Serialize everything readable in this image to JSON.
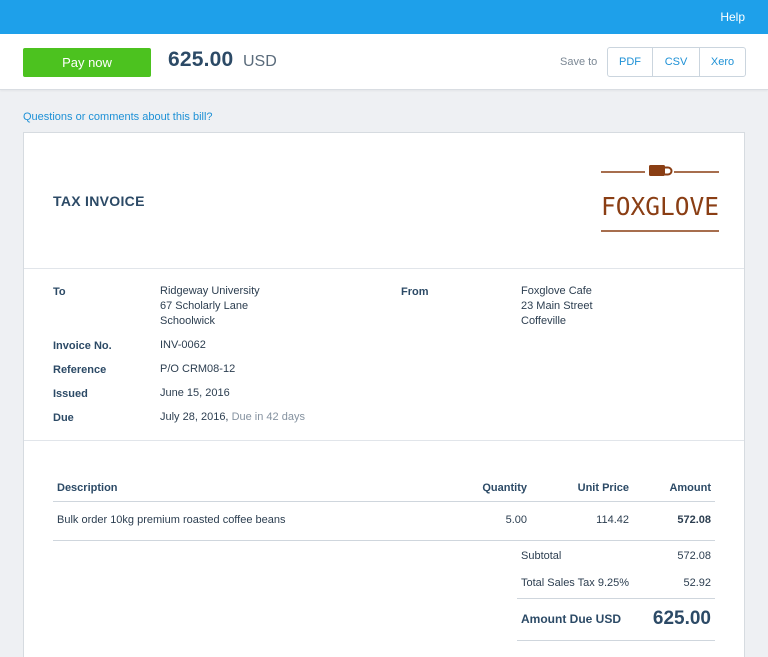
{
  "topbar": {
    "help_label": "Help"
  },
  "paybar": {
    "pay_label": "Pay now",
    "amount": "625.00",
    "currency": "USD",
    "save_to_label": "Save to",
    "exports": [
      "PDF",
      "CSV",
      "Xero"
    ]
  },
  "questions_link": "Questions or comments about this bill?",
  "invoice": {
    "title": "TAX INVOICE",
    "logo_text": "FOXGLOVE",
    "to_label": "To",
    "to_lines": [
      "Ridgeway University",
      "67 Scholarly Lane",
      "Schoolwick"
    ],
    "from_label": "From",
    "from_lines": [
      "Foxglove Cafe",
      "23 Main Street",
      "Coffeville"
    ],
    "invoice_no_label": "Invoice No.",
    "invoice_no": "INV-0062",
    "reference_label": "Reference",
    "reference": "P/O CRM08-12",
    "issued_label": "Issued",
    "issued": "June 15, 2016",
    "due_label": "Due",
    "due_date": "July 28, 2016,",
    "due_in": "Due in 42 days"
  },
  "table": {
    "headers": {
      "description": "Description",
      "quantity": "Quantity",
      "unit_price": "Unit Price",
      "amount": "Amount"
    },
    "rows": [
      {
        "description": "Bulk order 10kg premium roasted coffee beans",
        "quantity": "5.00",
        "unit_price": "114.42",
        "amount": "572.08"
      }
    ]
  },
  "totals": {
    "subtotal_label": "Subtotal",
    "subtotal": "572.08",
    "tax_label": "Total Sales Tax 9.25%",
    "tax": "52.92",
    "amount_due_label": "Amount Due USD",
    "amount_due": "625.00"
  },
  "colors": {
    "topbar": "#1ea0ea",
    "pay_button": "#4cc21f",
    "link": "#1e91d6",
    "logo_brown": "#8a3e14"
  },
  "icons": {
    "logo": "coffee-cup-icon"
  }
}
